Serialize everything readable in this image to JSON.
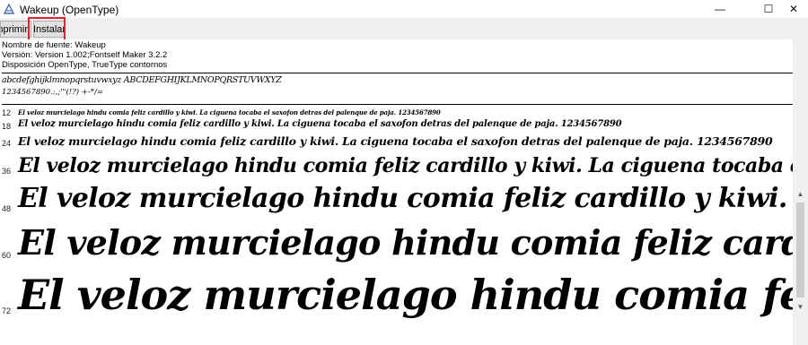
{
  "window": {
    "title": "Wakeup (OpenType)",
    "minimize_glyph": "—",
    "maximize_glyph": "☐",
    "close_glyph": "✕"
  },
  "toolbar": {
    "print_label": "Imprimir",
    "install_label": "Instalar"
  },
  "font_info": {
    "name_line": "Nombre de fuente: Wakeup",
    "version_line": "Versión: Version 1.002;Fontself Maker 3.2.2",
    "layout_line": "Disposición OpenType, TrueType  contornos"
  },
  "charset": {
    "letters": "abcdefghijklmnopqrstuvwxyz ABCDEFGHIJKLMNOPQRSTUVWXYZ",
    "digits": "1234567890.:,;'\"(!?) +-*/="
  },
  "samples": [
    {
      "size": "12",
      "text": "El veloz murcielago hindu comia feliz cardillo y kiwi. La ciguena tocaba el saxofon detras del palenque de paja. 1234567890"
    },
    {
      "size": "18",
      "text": "El veloz murcielago hindu comia feliz cardillo y kiwi. La ciguena tocaba el saxofon detras del palenque de paja. 1234567890"
    },
    {
      "size": "24",
      "text": "El veloz murcielago hindu comia feliz cardillo y kiwi. La ciguena tocaba el saxofon detras del palenque de paja. 1234567890"
    },
    {
      "size": "36",
      "text": "El veloz murcielago hindu comia feliz cardillo y kiwi. La ciguena tocaba el saxofon detras del palenque"
    },
    {
      "size": "48",
      "text": "El veloz murcielago hindu comia feliz cardillo y kiwi. La ciguena tocaba el saxofon"
    },
    {
      "size": "60",
      "text": "El veloz murcielago hindu comia feliz cardillo y kiwi. La ciguena"
    },
    {
      "size": "72",
      "text": "El veloz murcielago hindu comia feliz cardillo y kiwi."
    }
  ],
  "colors": {
    "highlight": "#e0212b"
  }
}
